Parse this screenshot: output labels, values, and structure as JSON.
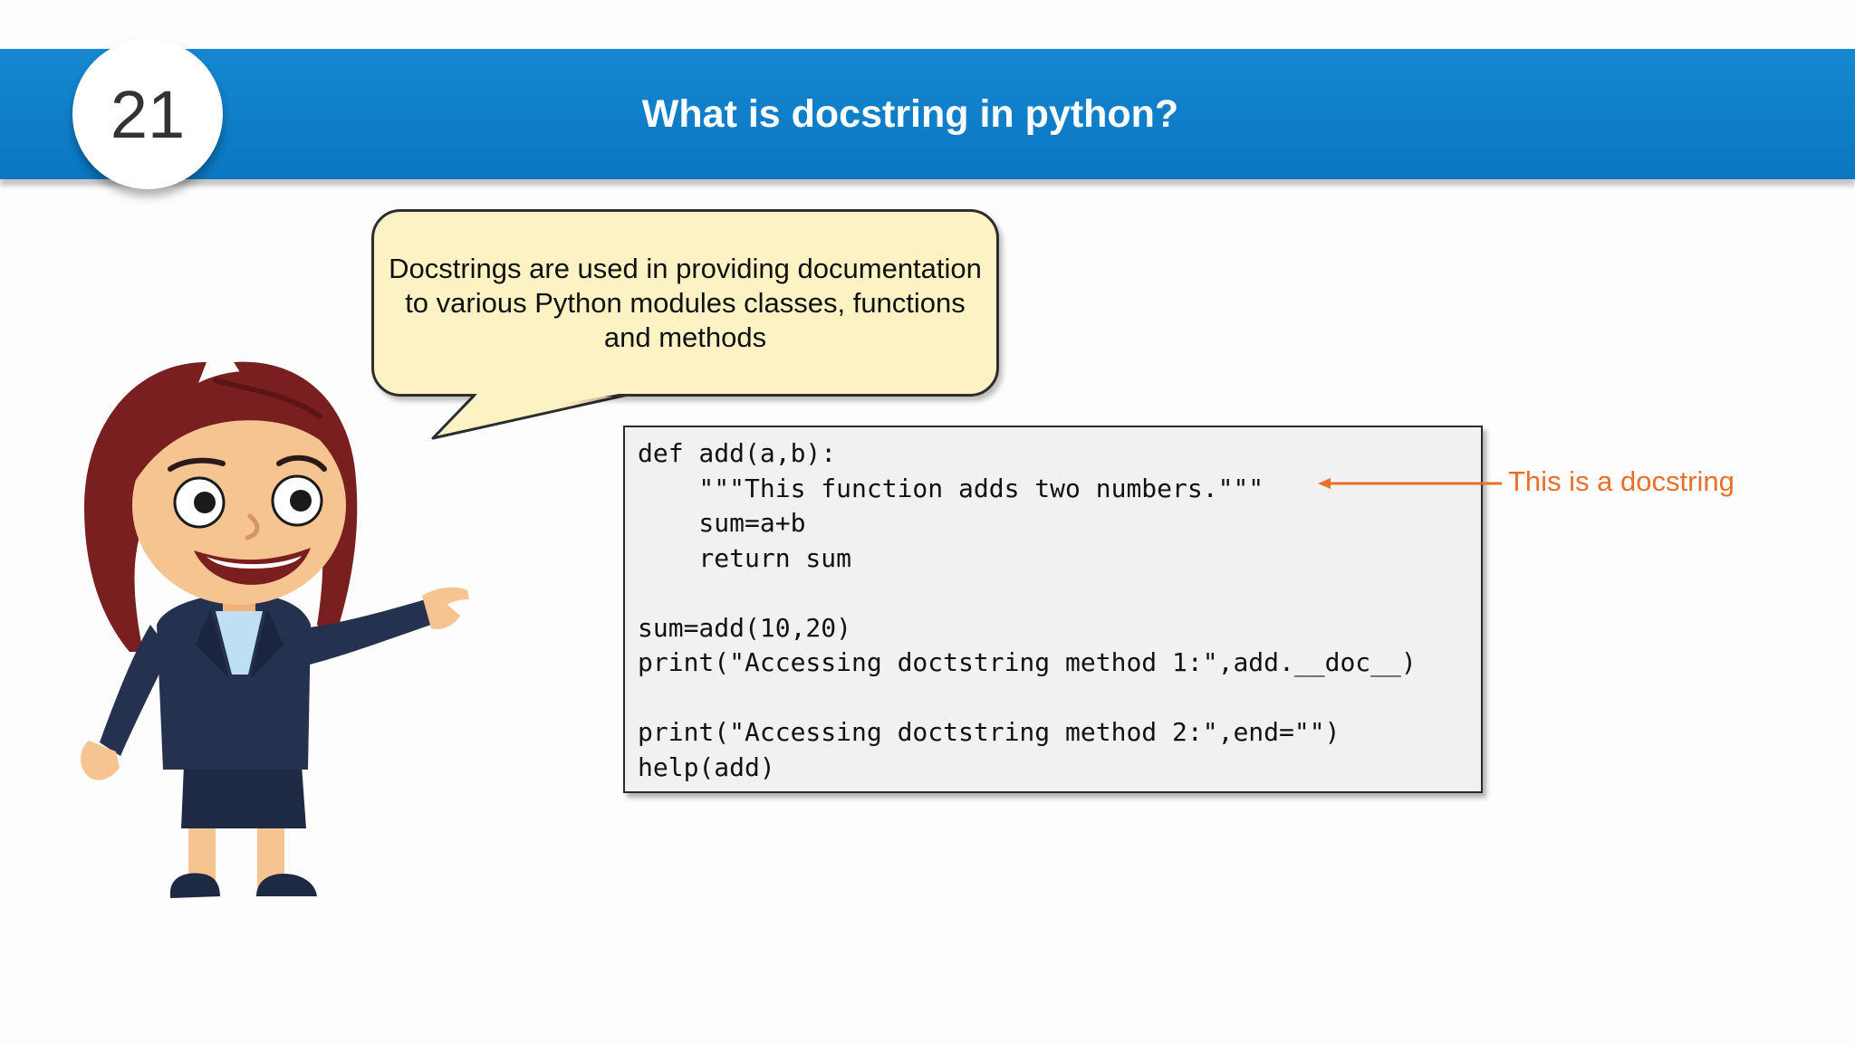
{
  "slide": {
    "number": "21",
    "title": "What is docstring in python?"
  },
  "bubble": {
    "text": "Docstrings are used in providing documentation\nto various Python modules classes, functions\nand methods"
  },
  "code": {
    "lines": [
      "def add(a,b):",
      "    \"\"\"This function adds two numbers.\"\"\"",
      "    sum=a+b",
      "    return sum",
      "",
      "sum=add(10,20)",
      "print(\"Accessing doctstring method 1:\",add.__doc__)",
      "",
      "print(\"Accessing doctstring method 2:\",end=\"\")",
      "help(add)"
    ]
  },
  "annotation": {
    "text": "This is a docstring",
    "color": "#e8702a"
  },
  "colors": {
    "header": "#0a77c2",
    "bubble": "#fdf2c4",
    "code_background": "#f1f1f1"
  },
  "icons": {
    "character": "teacher-character-illustration",
    "arrow": "arrow-left-icon"
  }
}
